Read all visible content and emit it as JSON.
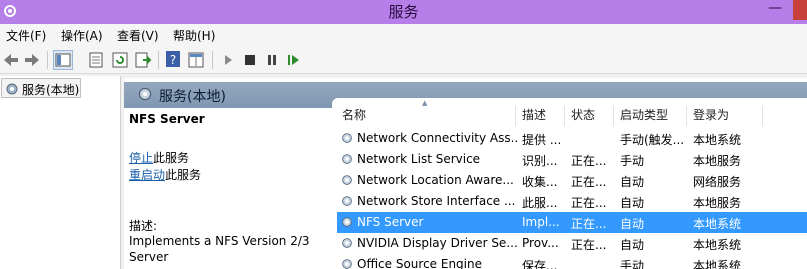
{
  "window": {
    "title": "服务",
    "minimize_glyph": "—"
  },
  "menu": [
    "文件(F)",
    "操作(A)",
    "查看(V)",
    "帮助(H)"
  ],
  "tree": {
    "root_label": "服务(本地)"
  },
  "main": {
    "header": "服务(本地)",
    "selected_service": "NFS Server",
    "stop_link": "停止",
    "stop_suffix": "此服务",
    "restart_link": "重启动",
    "restart_suffix": "此服务",
    "description_label": "描述:",
    "description_text": "Implements a NFS Version 2/3 Server"
  },
  "table": {
    "columns": [
      "名称",
      "描述",
      "状态",
      "启动类型",
      "登录为"
    ],
    "rows": [
      {
        "name": "Network Connectivity Ass...",
        "desc": "提供 ...",
        "status": "",
        "startup": "手动(触发...",
        "logon": "本地系统"
      },
      {
        "name": "Network List Service",
        "desc": "识别...",
        "status": "正在...",
        "startup": "手动",
        "logon": "本地服务"
      },
      {
        "name": "Network Location Aware...",
        "desc": "收集...",
        "status": "正在...",
        "startup": "自动",
        "logon": "网络服务"
      },
      {
        "name": "Network Store Interface ...",
        "desc": "此服...",
        "status": "正在...",
        "startup": "自动",
        "logon": "本地服务"
      },
      {
        "name": "NFS Server",
        "desc": "Impl...",
        "status": "正在...",
        "startup": "自动",
        "logon": "本地系统",
        "selected": true
      },
      {
        "name": "NVIDIA Display Driver Se...",
        "desc": "Prov...",
        "status": "正在...",
        "startup": "自动",
        "logon": "本地系统"
      },
      {
        "name": "Office  Source Engine",
        "desc": "保存...",
        "status": "",
        "startup": "手动",
        "logon": "本地系统"
      }
    ]
  },
  "colors": {
    "titlebar": "#b57ee8",
    "header": "#8aa0b8",
    "selection": "#3399ff",
    "link": "#1a5ea8"
  }
}
